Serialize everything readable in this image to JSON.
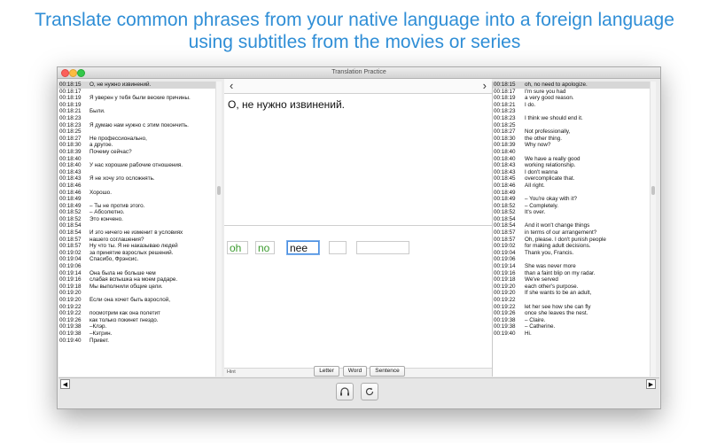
{
  "headline": {
    "line1": "Translate common phrases from your native language into a foreign language",
    "line2": "using subtitles from the movies or series"
  },
  "window": {
    "title": "Translation Practice"
  },
  "left_subtitles": [
    {
      "time": "00:18:15",
      "text": "О, не нужно извинений.",
      "selected": true
    },
    {
      "time": "00:18:17",
      "text": ""
    },
    {
      "time": "00:18:19",
      "text": "Я уверен у тебя были веские причины."
    },
    {
      "time": "00:18:19",
      "text": ""
    },
    {
      "time": "00:18:21",
      "text": "Были."
    },
    {
      "time": "00:18:23",
      "text": ""
    },
    {
      "time": "00:18:23",
      "text": "Я думаю нам нужно с этим покончить."
    },
    {
      "time": "00:18:25",
      "text": ""
    },
    {
      "time": "00:18:27",
      "text": "Не профессионально,"
    },
    {
      "time": "00:18:30",
      "text": "а другое."
    },
    {
      "time": "00:18:39",
      "text": "Почему сейчас?"
    },
    {
      "time": "00:18:40",
      "text": ""
    },
    {
      "time": "00:18:40",
      "text": "У нас хорошие рабочие отношения."
    },
    {
      "time": "00:18:43",
      "text": ""
    },
    {
      "time": "00:18:43",
      "text": "Я не хочу это осложнять."
    },
    {
      "time": "00:18:46",
      "text": ""
    },
    {
      "time": "00:18:46",
      "text": "Хорошо."
    },
    {
      "time": "00:18:49",
      "text": ""
    },
    {
      "time": "00:18:49",
      "text": "– Ты не против этого."
    },
    {
      "time": "00:18:52",
      "text": "– Абсолютно."
    },
    {
      "time": "00:18:52",
      "text": "Это кончено."
    },
    {
      "time": "00:18:54",
      "text": ""
    },
    {
      "time": "00:18:54",
      "text": "И это ничего не изменит в условиях"
    },
    {
      "time": "00:18:57",
      "text": "нашего соглашения?"
    },
    {
      "time": "00:18:57",
      "text": "Ну что ты. Я не наказываю людей"
    },
    {
      "time": "00:19:02",
      "text": "за принятие взрослых решений."
    },
    {
      "time": "00:19:04",
      "text": "Спасибо, Фрэнсис."
    },
    {
      "time": "00:19:06",
      "text": ""
    },
    {
      "time": "00:19:14",
      "text": "Она была не больше чем"
    },
    {
      "time": "00:19:16",
      "text": "слабая вспышка на моем радаре."
    },
    {
      "time": "00:19:18",
      "text": "Мы выполнили общие цели."
    },
    {
      "time": "00:19:20",
      "text": ""
    },
    {
      "time": "00:19:20",
      "text": "Если она хочет быть взрослой,"
    },
    {
      "time": "00:19:22",
      "text": ""
    },
    {
      "time": "00:19:22",
      "text": "посмотрим как она полетит"
    },
    {
      "time": "00:19:26",
      "text": "как только покинет гнездо."
    },
    {
      "time": "00:19:38",
      "text": "–Клэр."
    },
    {
      "time": "00:19:38",
      "text": "–Кэтрин."
    },
    {
      "time": "00:19:40",
      "text": "Привет."
    }
  ],
  "right_subtitles": [
    {
      "time": "00:18:15",
      "text": "oh, no need to apologize.",
      "selected": true
    },
    {
      "time": "00:18:17",
      "text": "I'm sure you had"
    },
    {
      "time": "00:18:19",
      "text": "a very good reason."
    },
    {
      "time": "00:18:21",
      "text": "I do."
    },
    {
      "time": "00:18:23",
      "text": ""
    },
    {
      "time": "00:18:23",
      "text": "I think we should end it."
    },
    {
      "time": "00:18:25",
      "text": ""
    },
    {
      "time": "00:18:27",
      "text": "Not professionally,"
    },
    {
      "time": "00:18:30",
      "text": "the other thing."
    },
    {
      "time": "00:18:39",
      "text": "Why now?"
    },
    {
      "time": "00:18:40",
      "text": ""
    },
    {
      "time": "00:18:40",
      "text": "We have a really good"
    },
    {
      "time": "00:18:43",
      "text": "working relationship."
    },
    {
      "time": "00:18:43",
      "text": "I don't wanna"
    },
    {
      "time": "00:18:45",
      "text": "overcomplicate that."
    },
    {
      "time": "00:18:46",
      "text": "All right."
    },
    {
      "time": "00:18:49",
      "text": ""
    },
    {
      "time": "00:18:49",
      "text": "– You're okay with it?"
    },
    {
      "time": "00:18:52",
      "text": "– Completely."
    },
    {
      "time": "00:18:52",
      "text": "It's over."
    },
    {
      "time": "00:18:54",
      "text": ""
    },
    {
      "time": "00:18:54",
      "text": "And it won't change things"
    },
    {
      "time": "00:18:57",
      "text": "in terms of our arrangement?"
    },
    {
      "time": "00:18:57",
      "text": "Oh, please. I don't punish people"
    },
    {
      "time": "00:19:02",
      "text": "for making adult decisions."
    },
    {
      "time": "00:19:04",
      "text": "Thank you, Francis."
    },
    {
      "time": "00:19:06",
      "text": ""
    },
    {
      "time": "00:19:14",
      "text": "She was never more"
    },
    {
      "time": "00:19:16",
      "text": "than a faint blip on my radar."
    },
    {
      "time": "00:19:18",
      "text": "We've served"
    },
    {
      "time": "00:19:20",
      "text": "each other's purpose."
    },
    {
      "time": "00:19:20",
      "text": "If she wants to be an adult,"
    },
    {
      "time": "00:19:22",
      "text": ""
    },
    {
      "time": "00:19:22",
      "text": "let her see how she can fly"
    },
    {
      "time": "00:19:26",
      "text": "once she leaves the nest."
    },
    {
      "time": "00:19:38",
      "text": "– Claire."
    },
    {
      "time": "00:19:38",
      "text": "– Catherine."
    },
    {
      "time": "00:19:40",
      "text": "Hi."
    }
  ],
  "center": {
    "prev_icon": "‹",
    "next_icon": "›",
    "phrase": "О, не нужно извинений.",
    "answer_tiles": [
      {
        "text": "oh",
        "state": "correct"
      },
      {
        "text": "no",
        "state": "correct"
      },
      {
        "text": "nee",
        "state": "active"
      },
      {
        "text": "",
        "state": "empty"
      },
      {
        "text": "",
        "state": "empty"
      }
    ],
    "hint_label": "Hint",
    "hint_buttons": [
      "Letter",
      "Word",
      "Sentence"
    ]
  },
  "controls": {
    "scroll_left_icon": "◀",
    "scroll_right_icon": "▶",
    "listen_icon": "headphones-icon",
    "repeat_icon": "refresh-icon"
  },
  "colors": {
    "headline": "#2f8ed6",
    "correct_word": "#3b9a2e",
    "active_border": "#4a8ee0",
    "selected_row": "#d7d7d7"
  }
}
